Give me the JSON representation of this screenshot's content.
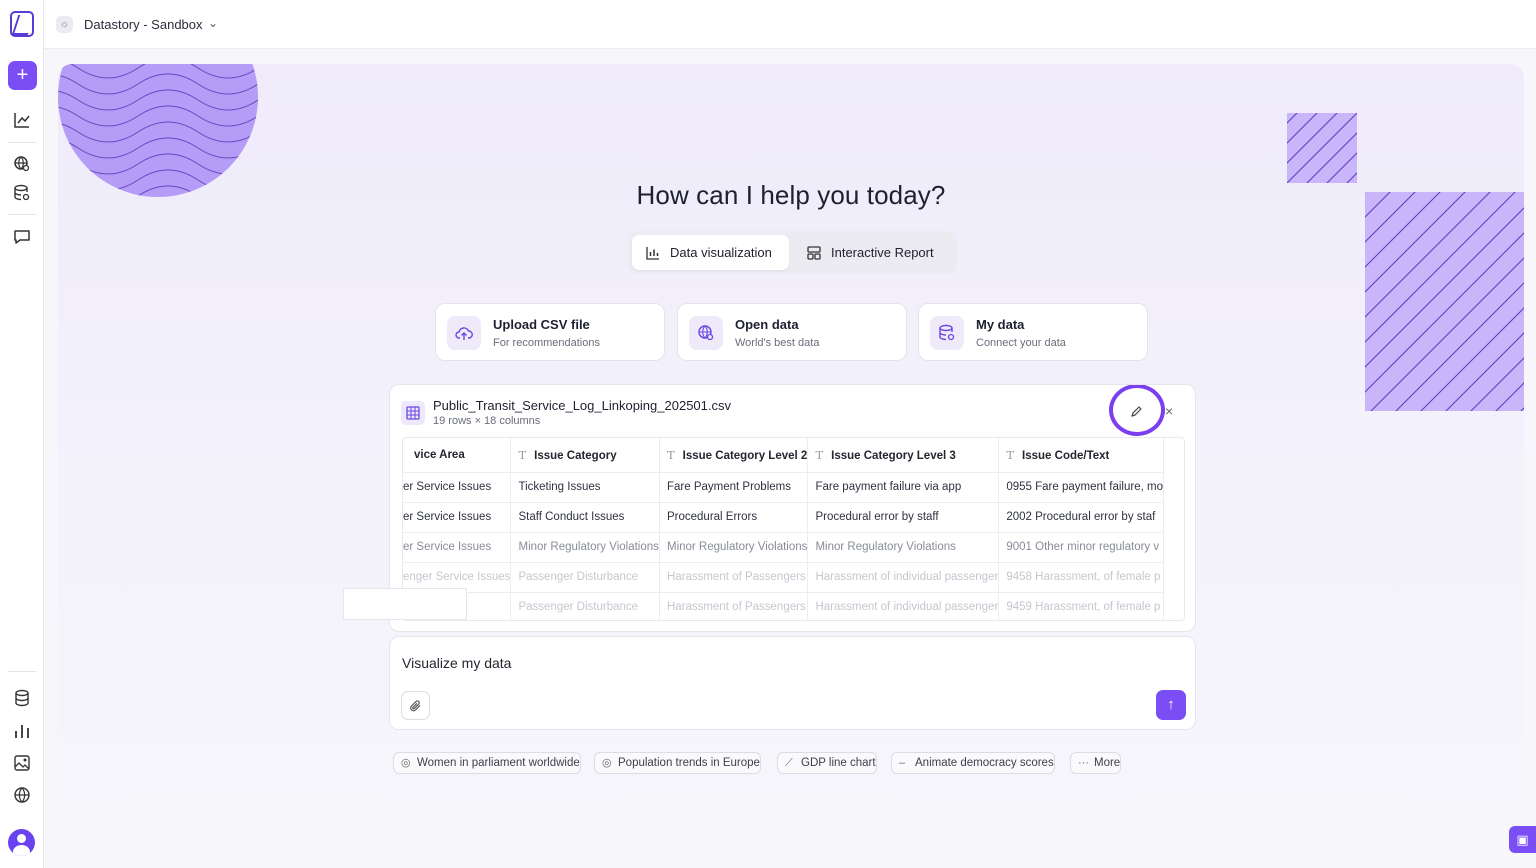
{
  "workspace": {
    "name": "Datastory - Sandbox"
  },
  "rail": {
    "icons": [
      "logo-icon",
      "plus-icon",
      "line-chart-icon",
      "globe-search-icon",
      "database-search-icon",
      "chat-icon",
      "database-icon",
      "bar-chart-icon",
      "image-icon",
      "globe-icon",
      "avatar"
    ]
  },
  "main": {
    "headline": "How can I help you today?",
    "tabs": [
      {
        "label": "Data visualization",
        "active": true
      },
      {
        "label": "Interactive Report",
        "active": false
      }
    ],
    "sources": [
      {
        "title": "Upload CSV file",
        "subtitle": "For recommendations",
        "icon": "cloud-upload-icon"
      },
      {
        "title": "Open data",
        "subtitle": "World's best data",
        "icon": "globe-search-icon"
      },
      {
        "title": "My data",
        "subtitle": "Connect your data",
        "icon": "database-search-icon"
      }
    ],
    "file": {
      "name": "Public_Transit_Service_Log_Linkoping_202501.csv",
      "meta": "19 rows × 18 columns",
      "columns": [
        "vice Area",
        "Issue Category",
        "Issue Category Level 2",
        "Issue Category Level 3",
        "Issue Code/Text"
      ],
      "rows": [
        [
          "er Service Issues",
          "Ticketing Issues",
          "Fare Payment Problems",
          "Fare payment failure via app",
          "0955 Fare payment failure, mo"
        ],
        [
          "er Service Issues",
          "Staff Conduct Issues",
          "Procedural Errors",
          "Procedural error by staff",
          "2002 Procedural error by staf"
        ],
        [
          "er Service Issues",
          "Minor Regulatory Violations",
          "Minor Regulatory Violations",
          "Minor Regulatory Violations",
          "9001 Other minor regulatory v"
        ],
        [
          "enger Service Issues",
          "Passenger Disturbance",
          "Harassment of Passengers",
          "Harassment of individual passenger",
          "9458 Harassment, of female p"
        ],
        [
          "",
          "Passenger Disturbance",
          "Harassment of Passengers",
          "Harassment of individual passenger",
          "9459 Harassment, of female p"
        ]
      ]
    },
    "composer": {
      "value": "Visualize my data"
    },
    "suggestions": [
      {
        "label": "Women in parliament worldwide",
        "icon": "globe-icon"
      },
      {
        "label": "Population trends in Europe",
        "icon": "globe-icon"
      },
      {
        "label": "GDP line chart",
        "icon": "line-chart-icon"
      },
      {
        "label": "Animate democracy scores",
        "icon": "dash-icon"
      },
      {
        "label": "More",
        "icon": "ellipsis-icon"
      }
    ]
  },
  "colors": {
    "accent": "#7b4df5",
    "deco": "#b59cf7"
  }
}
